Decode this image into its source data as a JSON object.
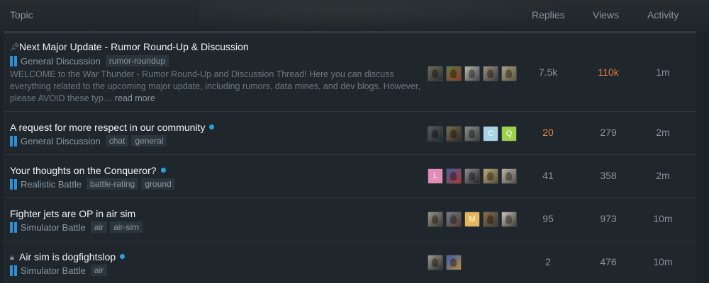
{
  "header": {
    "topic": "Topic",
    "replies": "Replies",
    "views": "Views",
    "activity": "Activity"
  },
  "colors": {
    "accent": "#2aa3dc",
    "category": "#2d8fd5",
    "hot": "#e8793b"
  },
  "topics": [
    {
      "lead_icon": "pin-icon",
      "title": "Next Major Update - Rumor Round-Up & Discussion",
      "category": "General Discussion",
      "tags": [
        "rumor-roundup"
      ],
      "excerpt": "WELCOME to the War Thunder - Rumor Round-Up and Discussion Thread! Here you can discuss everything related to the upcoming major update, including rumors, data mines, and dev blogs. However, please AVOID these typ…",
      "read_more": "read more",
      "replies": "7.5k",
      "views": "110k",
      "activity": "1m"
    },
    {
      "title": "A request for more respect in our community",
      "category": "General Discussion",
      "tags": [
        "chat",
        "general"
      ],
      "replies": "20",
      "views": "279",
      "activity": "2m"
    },
    {
      "title": "Your thoughts on the Conqueror?",
      "category": "Realistic Battle",
      "tags": [
        "battle-rating",
        "ground"
      ],
      "replies": "41",
      "views": "358",
      "activity": "2m"
    },
    {
      "title": "Fighter jets are OP in air sim",
      "category": "Simulator Battle",
      "tags": [
        "air",
        "air-sim"
      ],
      "replies": "95",
      "views": "973",
      "activity": "10m"
    },
    {
      "lead_icon": "lock-icon",
      "title": "Air sim is dogfightslop",
      "category": "Simulator Battle",
      "tags": [
        "air"
      ],
      "replies": "2",
      "views": "476",
      "activity": "10m"
    }
  ],
  "avatar_letters": {
    "c": "C",
    "q": "Q",
    "l": "L",
    "m": "M"
  }
}
